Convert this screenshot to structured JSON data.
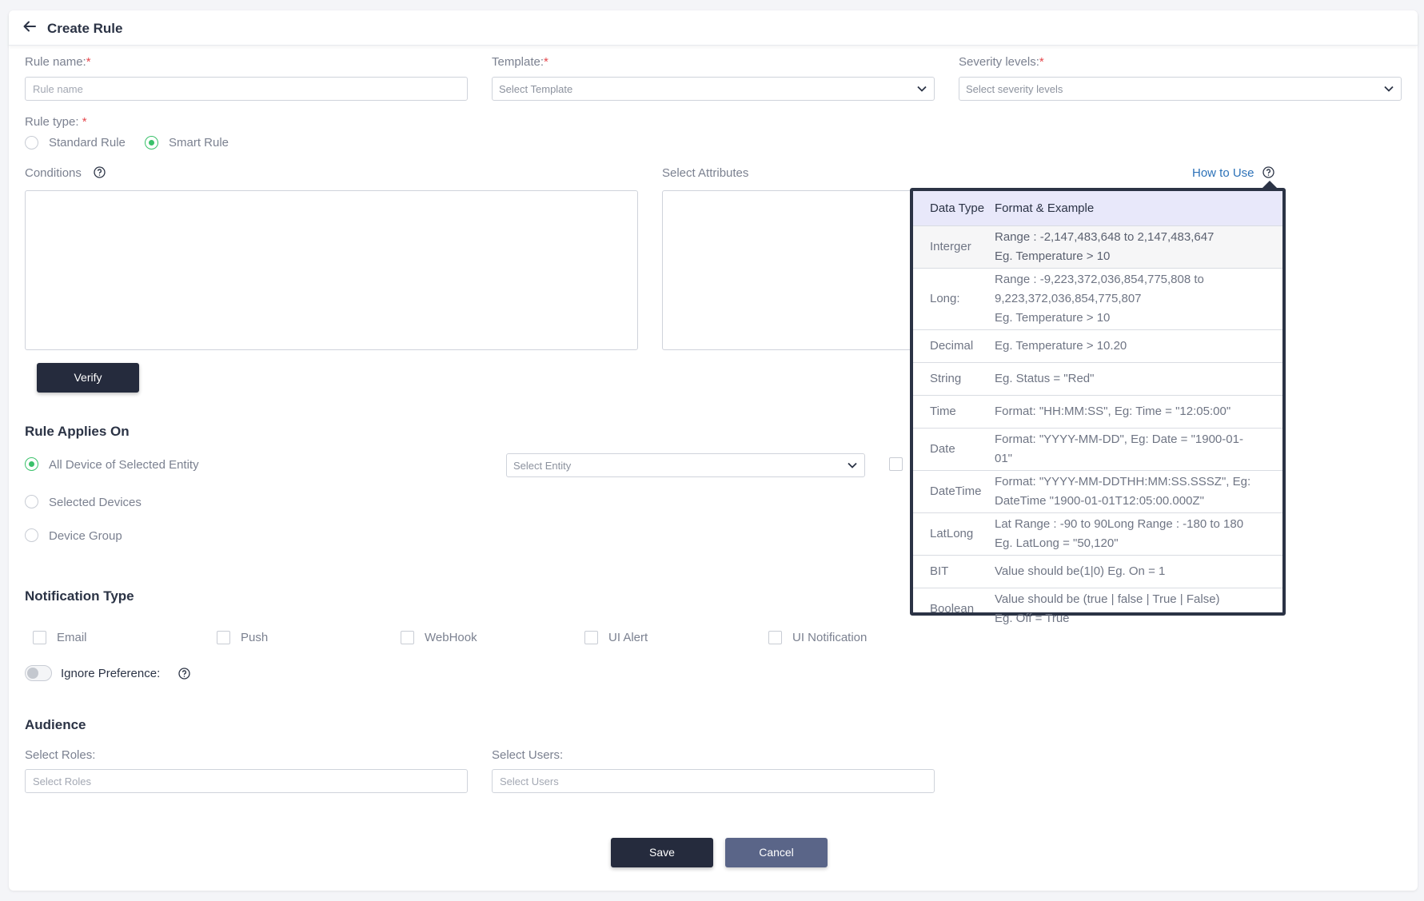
{
  "header": {
    "title": "Create Rule"
  },
  "form": {
    "rule_name_label": "Rule name:",
    "rule_name_placeholder": "Rule name",
    "template_label": "Template:",
    "template_placeholder": "Select Template",
    "severity_label": "Severity levels:",
    "severity_placeholder": "Select severity levels",
    "required_mark": "*",
    "rule_type_label": "Rule type:",
    "rule_type_options": [
      "Standard Rule",
      "Smart Rule"
    ],
    "rule_type_selected": "Smart Rule",
    "conditions_label": "Conditions",
    "select_attributes_label": "Select Attributes",
    "how_to_use": "How to Use",
    "verify_label": "Verify"
  },
  "applies": {
    "title": "Rule Applies On",
    "options": [
      "All Device of Selected Entity",
      "Selected Devices",
      "Device Group"
    ],
    "selected": "All Device of Selected Entity",
    "entity_placeholder": "Select Entity"
  },
  "notification": {
    "title": "Notification Type",
    "types": [
      "Email",
      "Push",
      "WebHook",
      "UI Alert",
      "UI Notification"
    ],
    "ignore_preference": "Ignore Preference:"
  },
  "audience": {
    "title": "Audience",
    "roles_label": "Select Roles:",
    "roles_placeholder": "Select Roles",
    "users_label": "Select Users:",
    "users_placeholder": "Select Users"
  },
  "actions": {
    "save": "Save",
    "cancel": "Cancel"
  },
  "help_table": {
    "headers": [
      "Data Type",
      "Format & Example"
    ],
    "rows": [
      {
        "type": "Interger",
        "format": [
          "Range : -2,147,483,648 to 2,147,483,647",
          "Eg. Temperature > 10"
        ]
      },
      {
        "type": "Long:",
        "format": [
          "Range : -9,223,372,036,854,775,808 to",
          "9,223,372,036,854,775,807",
          "Eg. Temperature > 10"
        ]
      },
      {
        "type": "Decimal",
        "format": [
          "Eg. Temperature > 10.20"
        ]
      },
      {
        "type": "String",
        "format": [
          "Eg. Status = \"Red\""
        ]
      },
      {
        "type": "Time",
        "format": [
          "Format: \"HH:MM:SS\", Eg: Time = \"12:05:00\""
        ]
      },
      {
        "type": "Date",
        "format": [
          "Format: \"YYYY-MM-DD\", Eg: Date = \"1900-01-",
          "01\""
        ]
      },
      {
        "type": "DateTime",
        "format": [
          "Format: \"YYYY-MM-DDTHH:MM:SS.SSSZ\", Eg:",
          "DateTime \"1900-01-01T12:05:00.000Z\""
        ]
      },
      {
        "type": "LatLong",
        "format": [
          "Lat Range : -90 to 90Long Range : -180 to 180",
          "Eg. LatLong = \"50,120\""
        ]
      },
      {
        "type": "BIT",
        "format": [
          "Value should be(1|0) Eg. On = 1"
        ]
      },
      {
        "type": "Boolean",
        "format": [
          "Value should be (true | false | True | False)",
          "Eg. Off = True"
        ]
      }
    ]
  }
}
